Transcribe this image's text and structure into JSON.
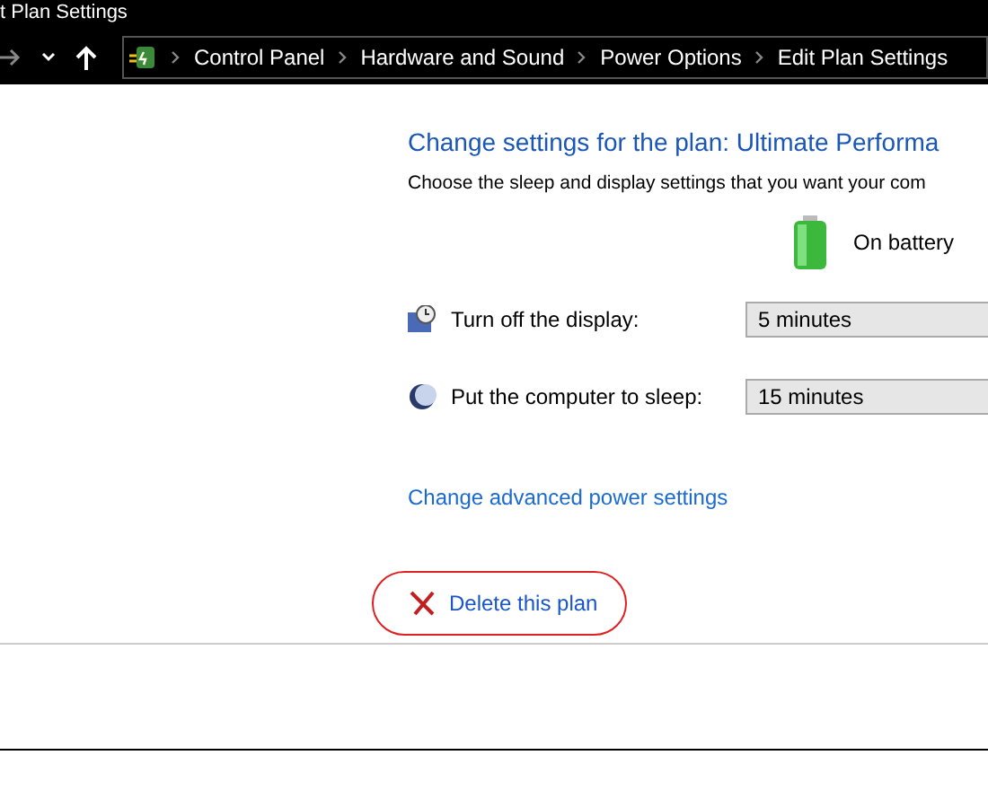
{
  "window": {
    "title": "t Plan Settings"
  },
  "breadcrumb": [
    "Control Panel",
    "Hardware and Sound",
    "Power Options",
    "Edit Plan Settings"
  ],
  "heading": "Change settings for the plan: Ultimate Performa",
  "subheading": "Choose the sleep and display settings that you want your com",
  "column_header": "On battery",
  "settings": [
    {
      "kind": "display",
      "label": "Turn off the display:",
      "value": "5 minutes"
    },
    {
      "kind": "sleep",
      "label": "Put the computer to sleep:",
      "value": "15 minutes"
    }
  ],
  "advanced_link": "Change advanced power settings",
  "delete_link": {
    "label": "Delete this plan",
    "highlighted": true
  }
}
